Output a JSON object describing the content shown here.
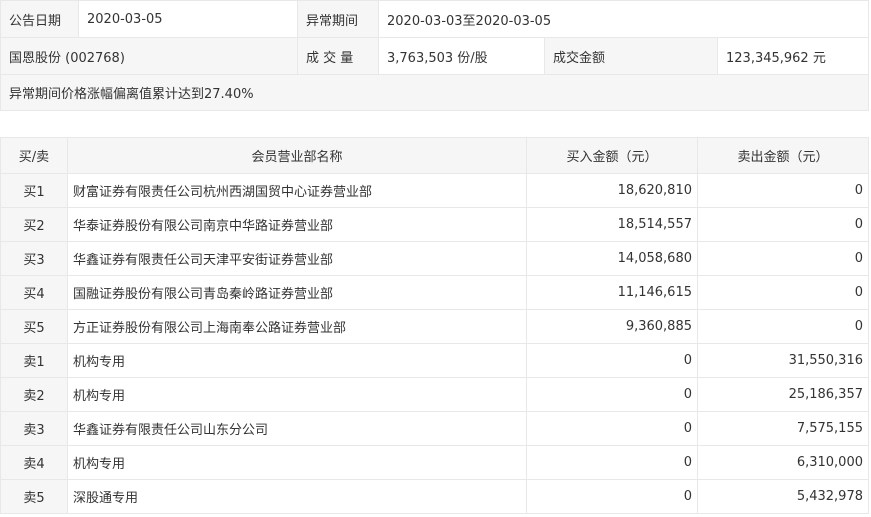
{
  "info": {
    "announce_date_label": "公告日期",
    "announce_date": "2020-03-05",
    "abnormal_period_label": "异常期间",
    "abnormal_period": "2020-03-03至2020-03-05",
    "stock": "国恩股份 (002768)",
    "volume_label": "成 交 量",
    "volume": "3,763,503 份/股",
    "amount_label": "成交金额",
    "amount": "123,345,962 元",
    "note": "异常期间价格涨幅偏离值累计达到27.40%"
  },
  "table": {
    "headers": [
      "买/卖",
      "会员营业部名称",
      "买入金额（元）",
      "卖出金额（元）"
    ],
    "rows": [
      {
        "side": "买1",
        "name": "财富证券有限责任公司杭州西湖国贸中心证券营业部",
        "buy": "18,620,810",
        "sell": "0"
      },
      {
        "side": "买2",
        "name": "华泰证券股份有限公司南京中华路证券营业部",
        "buy": "18,514,557",
        "sell": "0"
      },
      {
        "side": "买3",
        "name": "华鑫证券有限责任公司天津平安街证券营业部",
        "buy": "14,058,680",
        "sell": "0"
      },
      {
        "side": "买4",
        "name": "国融证券股份有限公司青岛秦岭路证券营业部",
        "buy": "11,146,615",
        "sell": "0"
      },
      {
        "side": "买5",
        "name": "方正证券股份有限公司上海南奉公路证券营业部",
        "buy": "9,360,885",
        "sell": "0"
      },
      {
        "side": "卖1",
        "name": "机构专用",
        "buy": "0",
        "sell": "31,550,316"
      },
      {
        "side": "卖2",
        "name": "机构专用",
        "buy": "0",
        "sell": "25,186,357"
      },
      {
        "side": "卖3",
        "name": "华鑫证券有限责任公司山东分公司",
        "buy": "0",
        "sell": "7,575,155"
      },
      {
        "side": "卖4",
        "name": "机构专用",
        "buy": "0",
        "sell": "6,310,000"
      },
      {
        "side": "卖5",
        "name": "深股通专用",
        "buy": "0",
        "sell": "5,432,978"
      }
    ]
  }
}
